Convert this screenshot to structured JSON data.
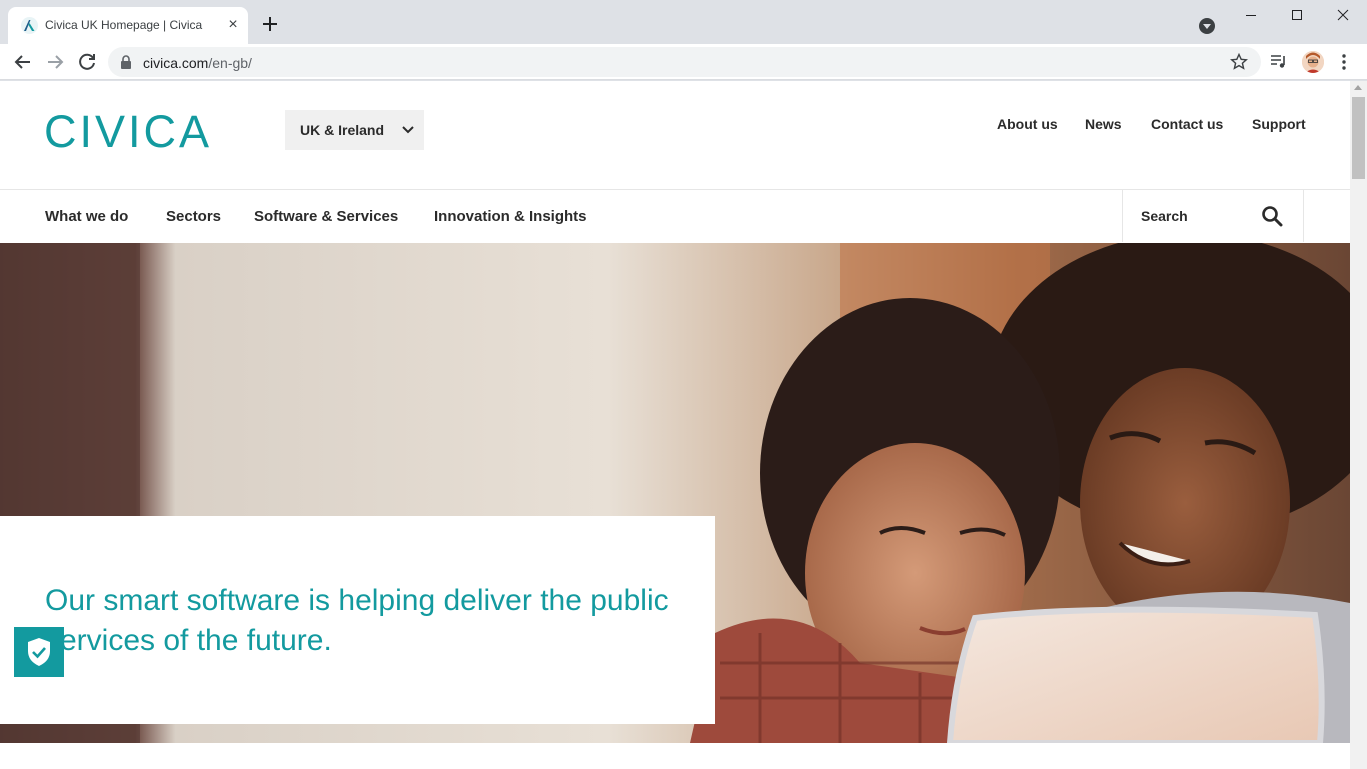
{
  "browser": {
    "tab_title": "Civica UK Homepage | Civica",
    "tab_close": "×",
    "url_host": "civica.com",
    "url_path": "/en-gb/"
  },
  "header": {
    "logo_text": "CIVICA",
    "region_label": "UK & Ireland",
    "top_links": [
      "About us",
      "News",
      "Contact us",
      "Support"
    ]
  },
  "main_nav": {
    "items": [
      "What we do",
      "Sectors",
      "Software & Services",
      "Innovation & Insights"
    ],
    "search_label": "Search"
  },
  "hero": {
    "headline": "Our smart software is helping deliver the public services of the future."
  },
  "colors": {
    "brand_teal": "#139a9f",
    "text_dark": "#2b2b2b",
    "chrome_bg": "#dee1e6"
  },
  "icons": [
    "civica-favicon-icon",
    "plus-icon",
    "back-arrow-icon",
    "forward-arrow-icon",
    "reload-icon",
    "lock-icon",
    "star-icon",
    "media-control-icon",
    "more-vert-icon",
    "chevron-down-icon",
    "search-icon",
    "shield-check-icon"
  ]
}
